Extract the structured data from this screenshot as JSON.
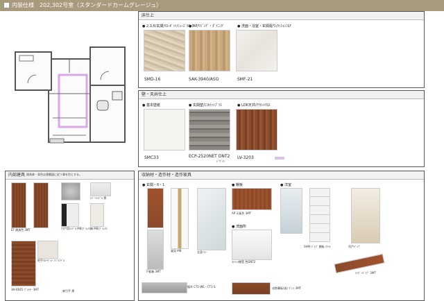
{
  "header": {
    "title": "内装仕様　202,302号室（スタンダードカームグレージュ）"
  },
  "floor_section": {
    "title": "床仕上",
    "items": [
      {
        "label": "● 2,3,6/玄関/ｸﾛｰｾﾞｯﾄ/ｼｭｰｽﾞｸﾛｰｸ",
        "code": "SMD-16"
      },
      {
        "label": "● AP/ﾘﾋﾞﾝｸﾞ・ﾀﾞｲﾆﾝｸﾞ",
        "code": "SAK-3940/ASG"
      },
      {
        "label": "● 洗面・浴室・玄関廻り/ｸｯｼｮﾝﾌﾛｱ",
        "code": "SMF-21"
      }
    ]
  },
  "wall_section": {
    "title": "壁・天井仕上",
    "items": [
      {
        "label": "● 基本壁紙",
        "code": "SMC33"
      },
      {
        "label": "● 玄関壁/ｴｺｶﾗｯﾄﾌﾟﾗｽ",
        "code": "ECP-2520NET DNT2"
      },
      {
        "label": "● LDK天井/ｱｸｾﾝﾄｸﾛｽ",
        "code": "LV-3203"
      }
    ],
    "note": "ﾃﾞｻﾞｲﾝ"
  },
  "interior_section": {
    "title": "内部建具",
    "subtitle": "建具扉・表色は建築図に従う事を別とする。",
    "items": [
      {
        "label": "EF 建具色 3MT"
      },
      {
        "label": "ﾚﾊﾞｰﾊﾝﾄﾞﾙ 黒"
      },
      {
        "label": "扉引手 黒"
      },
      {
        "label": "引戸用ﾊﾝﾄﾞﾙ MB(ﾌﾞﾗｯｸ)"
      },
      {
        "label": "扉 MB(ﾌﾞﾗｯｸ)"
      },
      {
        "label": "3H-6935 ﾌﾟﾗｲﾀｰ 3MT"
      },
      {
        "label": "把手ｸﾛｰｾﾞｯﾄ ﾉﾌﾞﾊﾝﾄﾞﾙ"
      }
    ]
  },
  "storage_section": {
    "title": "収納材・造作材・造作家具",
    "groups": [
      {
        "heading": "● 玄関・6・1",
        "label": "下駄箱 3MT"
      },
      {
        "heading": "",
        "label": "姿見 MB"
      },
      {
        "heading": "",
        "label": "全身ﾐﾗｰ"
      },
      {
        "heading": "● 棚板",
        "label": "AP 天板色 3MT"
      },
      {
        "heading": "● 洗面所",
        "label": "ｽﾃﾝﾚｽ棚受 色DNT2"
      },
      {
        "heading": "● 洋室",
        "label": "SHM-ﾊﾟｲﾌﾟ 棚板 ﾎﾜｲﾄ"
      },
      {
        "heading": "",
        "label": "吊戸ﾊﾟｲﾌﾟ"
      },
      {
        "heading": "",
        "label": "ﾊﾝｶﾞｰﾊﾟｲﾌﾟ 3MT"
      },
      {
        "heading": "",
        "label": "棚ﾊﾟｲﾌﾟ MB"
      },
      {
        "heading": "",
        "label": "ｸｯｼｮﾝ"
      },
      {
        "heading": "",
        "label": "化粧幕板(仮) ｸﾞﾚｲ 3MT"
      },
      {
        "heading": "",
        "label": "幅木 CT1-WE・CT1-S"
      }
    ]
  },
  "colors": {
    "header_bg": "#a89a7c",
    "wood_dark": "#8a4b2b",
    "wood_light": "#c9a66b"
  }
}
